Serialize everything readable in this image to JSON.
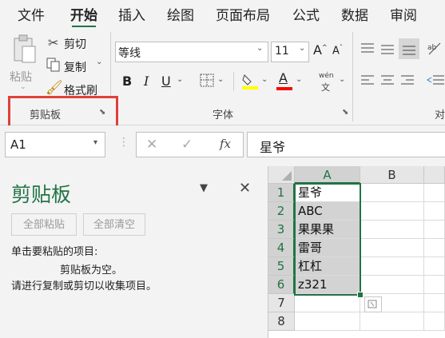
{
  "menu": {
    "tabs": [
      "文件",
      "开始",
      "插入",
      "绘图",
      "页面布局",
      "公式",
      "数据",
      "审阅"
    ],
    "active_index": 1
  },
  "ribbon": {
    "clipboard": {
      "paste": "粘贴",
      "cut": "剪切",
      "copy": "复制",
      "format_painter": "格式刷",
      "group_label": "剪贴板"
    },
    "font": {
      "font_name": "等线",
      "font_size": "11",
      "bold": "B",
      "italic": "I",
      "underline": "U",
      "wen": "wén",
      "wen_sub": "文",
      "group_label": "字体"
    },
    "alignment": {
      "group_label_partial": "对"
    },
    "highlight_color": "#ff0000",
    "fill_color": "#ffff00",
    "font_color": "#ff0000"
  },
  "formula_bar": {
    "name_box": "A1",
    "fx": "fx",
    "content": "星爷"
  },
  "clipboard_pane": {
    "title": "剪贴板",
    "paste_all": "全部粘贴",
    "clear_all": "全部清空",
    "instruction": "单击要粘贴的项目:",
    "empty_message": "剪贴板为空。",
    "hint": "请进行复制或剪切以收集项目。"
  },
  "sheet": {
    "columns": [
      "A",
      "B"
    ],
    "rows": [
      "1",
      "2",
      "3",
      "4",
      "5",
      "6",
      "7",
      "8"
    ],
    "cells_a": [
      "星爷",
      "ABC",
      "果果果",
      "雷哥",
      "杠杠",
      "z321",
      "",
      ""
    ],
    "selection_color": "#217346"
  }
}
